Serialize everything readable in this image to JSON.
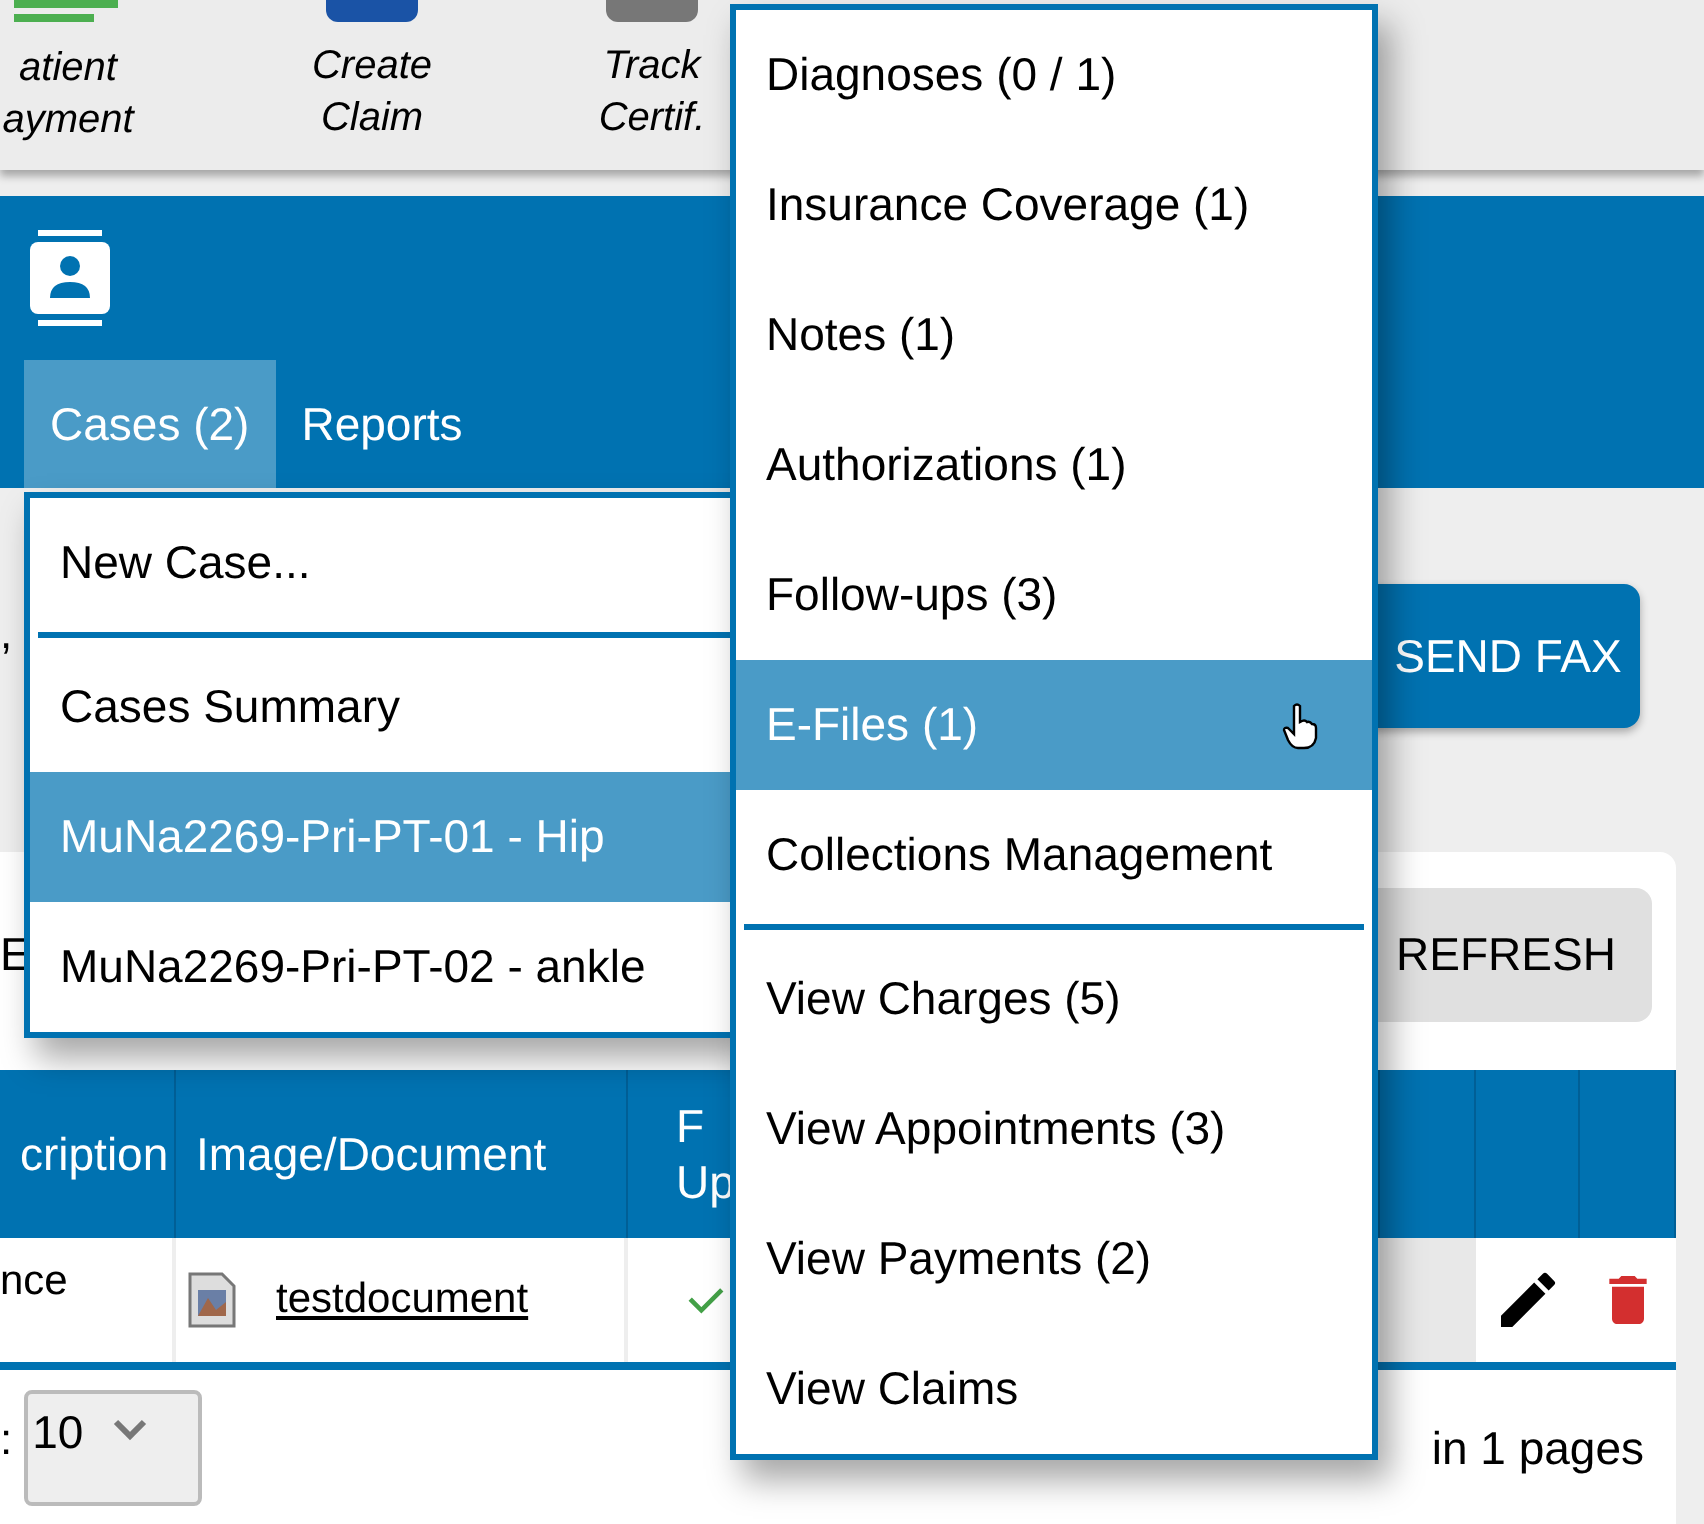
{
  "toolbar": {
    "items": [
      {
        "lines": [
          "atient",
          "ayment"
        ],
        "kind": "lines"
      },
      {
        "lines": [
          "Create",
          "Claim"
        ],
        "kind": "square"
      },
      {
        "lines": [
          "Track",
          "Certif."
        ],
        "kind": "gray"
      }
    ]
  },
  "header": {
    "tabs": [
      {
        "label": "Cases (2)",
        "selected": true
      },
      {
        "label": "Reports",
        "selected": false
      }
    ]
  },
  "cases_menu": {
    "items": [
      {
        "kind": "item",
        "label": "New Case...",
        "selected": false
      },
      {
        "kind": "divider"
      },
      {
        "kind": "item",
        "label": "Cases Summary",
        "selected": false
      },
      {
        "kind": "item",
        "label": "MuNa2269-Pri-PT-01 - Hip",
        "selected": true
      },
      {
        "kind": "item",
        "label": "MuNa2269-Pri-PT-02 - ankle",
        "selected": false
      }
    ]
  },
  "case_menu": {
    "items": [
      {
        "kind": "item",
        "label": "Diagnoses (0 / 1)",
        "selected": false
      },
      {
        "kind": "item",
        "label": "Insurance Coverage (1)",
        "selected": false
      },
      {
        "kind": "item",
        "label": "Notes (1)",
        "selected": false
      },
      {
        "kind": "item",
        "label": "Authorizations (1)",
        "selected": false
      },
      {
        "kind": "item",
        "label": "Follow-ups (3)",
        "selected": false
      },
      {
        "kind": "item",
        "label": "E-Files (1)",
        "selected": true
      },
      {
        "kind": "item",
        "label": "Collections Management",
        "selected": false
      },
      {
        "kind": "divider"
      },
      {
        "kind": "item",
        "label": "View Charges (5)",
        "selected": false
      },
      {
        "kind": "item",
        "label": "View Appointments (3)",
        "selected": false
      },
      {
        "kind": "item",
        "label": "View Payments (2)",
        "selected": false
      },
      {
        "kind": "item",
        "label": "View Claims",
        "selected": false
      }
    ]
  },
  "left_fragment": ",",
  "send_fax": "SEND FAX",
  "card": {
    "left_fragment": "E",
    "refresh": "REFRESH",
    "table": {
      "columns": [
        {
          "lines": [
            "cription"
          ]
        },
        {
          "lines": [
            "Image/Document"
          ]
        },
        {
          "lines": [
            "F",
            "Up"
          ]
        }
      ],
      "rows": [
        {
          "description": "nce",
          "document": "testdocument",
          "uploaded": true
        }
      ]
    },
    "footer": {
      "label": ":",
      "page_size": "10",
      "page_info": "in 1 pages"
    }
  }
}
